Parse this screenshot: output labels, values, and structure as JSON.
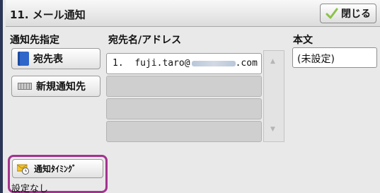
{
  "window": {
    "title": "11. メール通知"
  },
  "header": {
    "close_label": "閉じる"
  },
  "recipient_spec": {
    "label": "通知先指定",
    "address_book_label": "宛先表",
    "new_recipient_label": "新規通知先"
  },
  "address_list": {
    "header": "宛先名/アドレス",
    "rows": [
      {
        "number": "1.",
        "address_prefix": "fuji.taro@",
        "address_suffix": ".com"
      },
      {
        "number": "",
        "address_prefix": "",
        "address_suffix": ""
      },
      {
        "number": "",
        "address_prefix": "",
        "address_suffix": ""
      },
      {
        "number": "",
        "address_prefix": "",
        "address_suffix": ""
      }
    ]
  },
  "body_text": {
    "label": "本文",
    "value": "(未設定)"
  },
  "timing": {
    "button_label": "通知ﾀｲﾐﾝｸﾞ",
    "status": "設定なし"
  },
  "colors": {
    "highlight_border": "#a4328f",
    "screen_bg": "#e9e9e9",
    "frame": "#2b3656"
  }
}
